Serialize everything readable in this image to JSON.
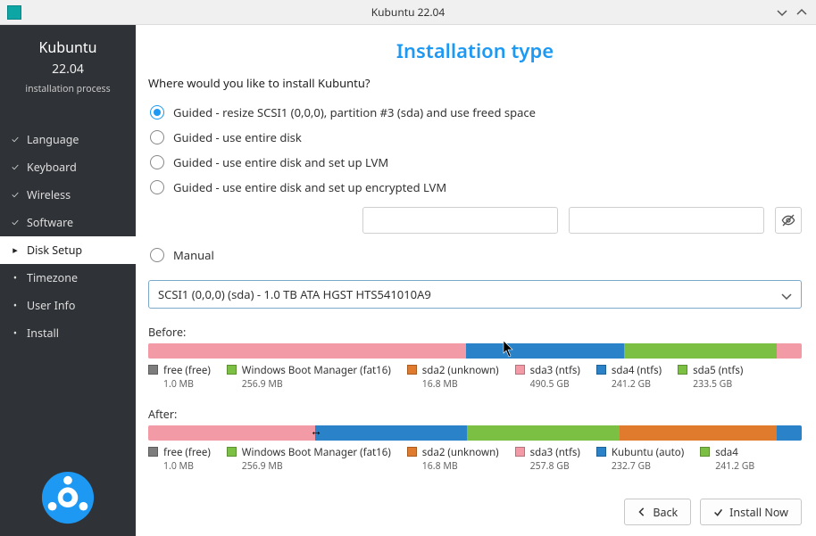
{
  "window": {
    "title": "Kubuntu 22.04"
  },
  "sidebar": {
    "product": "Kubuntu",
    "version": "22.04",
    "subtitle": "installation process",
    "steps": [
      {
        "label": "Language",
        "done": true,
        "active": false
      },
      {
        "label": "Keyboard",
        "done": true,
        "active": false
      },
      {
        "label": "Wireless",
        "done": true,
        "active": false
      },
      {
        "label": "Software",
        "done": true,
        "active": false
      },
      {
        "label": "Disk Setup",
        "done": false,
        "active": true
      },
      {
        "label": "Timezone",
        "done": false,
        "active": false
      },
      {
        "label": "User Info",
        "done": false,
        "active": false
      },
      {
        "label": "Install",
        "done": false,
        "active": false
      }
    ]
  },
  "page": {
    "heading": "Installation type",
    "question": "Where would you like to install Kubuntu?",
    "options": [
      {
        "label": "Guided - resize SCSI1 (0,0,0), partition #3 (sda) and use freed space",
        "selected": true
      },
      {
        "label": "Guided - use entire disk",
        "selected": false
      },
      {
        "label": "Guided - use entire disk and set up LVM",
        "selected": false
      },
      {
        "label": "Guided - use entire disk and set up encrypted LVM",
        "selected": false
      },
      {
        "label": "Manual",
        "selected": false
      }
    ],
    "disk_selected": "SCSI1 (0,0,0) (sda) - 1.0 TB ATA HGST HTS541010A9",
    "before": {
      "title": "Before:",
      "segments": [
        {
          "color": "c-pink",
          "pct": 48.6
        },
        {
          "color": "c-blue",
          "pct": 24.2
        },
        {
          "color": "c-green",
          "pct": 23.4
        },
        {
          "color": "c-pink",
          "pct": 3.8
        }
      ],
      "legend": [
        {
          "color": "c-grey",
          "l1": "free (free)",
          "l2": "1.0 MB"
        },
        {
          "color": "c-green",
          "l1": "Windows Boot Manager (fat16)",
          "l2": "256.9 MB"
        },
        {
          "color": "c-orange",
          "l1": "sda2 (unknown)",
          "l2": "16.8 MB"
        },
        {
          "color": "c-pink",
          "l1": "sda3 (ntfs)",
          "l2": "490.5 GB"
        },
        {
          "color": "c-blue",
          "l1": "sda4 (ntfs)",
          "l2": "241.2 GB"
        },
        {
          "color": "c-green",
          "l1": "sda5 (ntfs)",
          "l2": "233.5 GB"
        }
      ]
    },
    "after": {
      "title": "After:",
      "segments": [
        {
          "color": "c-pink",
          "pct": 25.6
        },
        {
          "color": "c-blue",
          "pct": 23.2
        },
        {
          "color": "c-green",
          "pct": 23.4
        },
        {
          "color": "c-orange",
          "pct": 24.0
        },
        {
          "color": "c-blue",
          "pct": 3.8
        }
      ],
      "legend": [
        {
          "color": "c-grey",
          "l1": "free (free)",
          "l2": "1.0 MB"
        },
        {
          "color": "c-green",
          "l1": "Windows Boot Manager (fat16)",
          "l2": "256.9 MB"
        },
        {
          "color": "c-orange",
          "l1": "sda2 (unknown)",
          "l2": "16.8 MB"
        },
        {
          "color": "c-pink",
          "l1": "sda3 (ntfs)",
          "l2": "257.8 GB"
        },
        {
          "color": "c-blue",
          "l1": "Kubuntu (auto)",
          "l2": "232.7 GB"
        },
        {
          "color": "c-green",
          "l1": "sda4",
          "l2": "241.2 GB"
        }
      ]
    },
    "buttons": {
      "back": "Back",
      "install": "Install Now"
    }
  }
}
